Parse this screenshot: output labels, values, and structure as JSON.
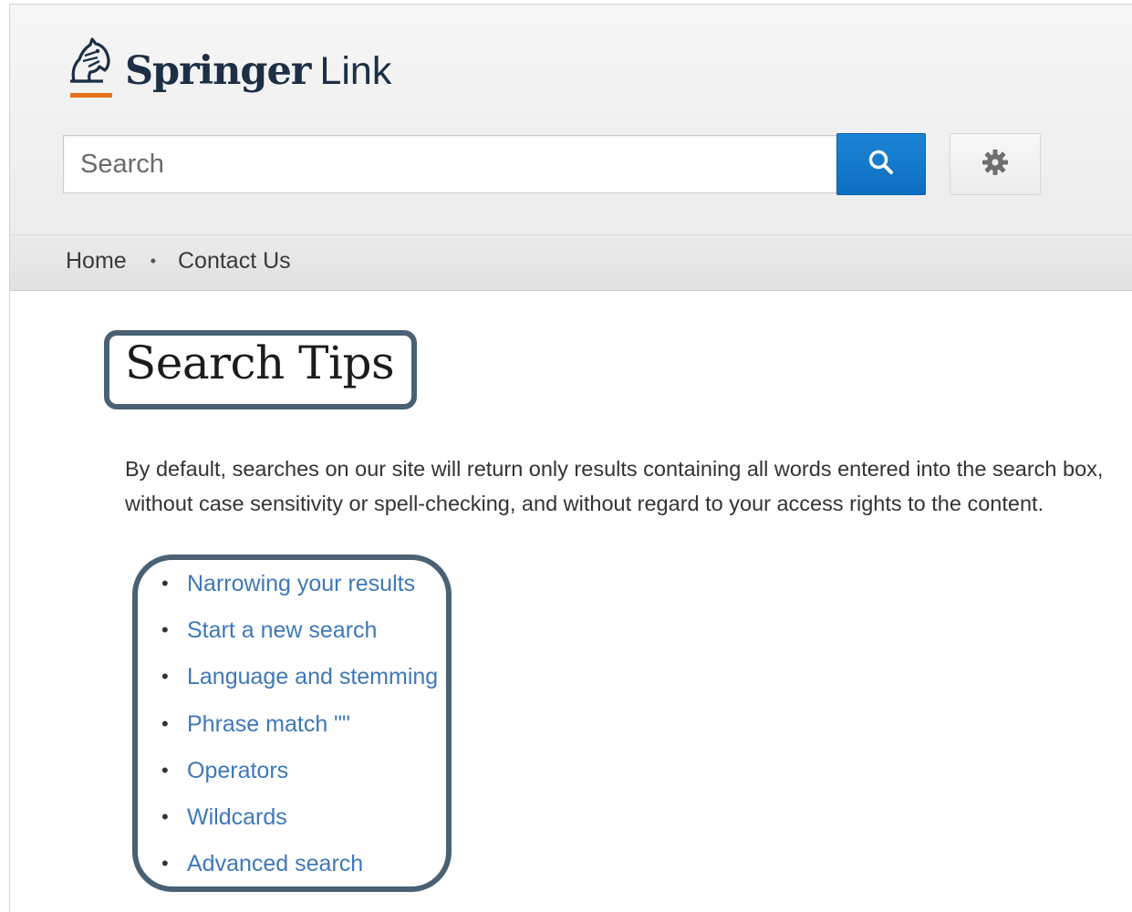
{
  "colors": {
    "brand_navy": "#1c2f45",
    "brand_orange": "#e5731d",
    "search_button_blue": "#1479cc",
    "link_blue": "#3e78b8",
    "annotation_border": "#4a6173"
  },
  "header": {
    "logo": {
      "icon": "springer-horse-icon",
      "brand_primary": "Springer",
      "brand_secondary": "Link"
    },
    "search": {
      "placeholder": "Search",
      "value": "",
      "submit_icon": "search-icon",
      "settings_icon": "gear-icon"
    }
  },
  "nav": {
    "items": [
      {
        "label": "Home"
      },
      {
        "label": "Contact Us"
      }
    ],
    "separator": "•"
  },
  "main": {
    "title": "Search Tips",
    "intro": "By default, searches on our site will return only results containing all words entered into the search box, without case sensitivity or spell-checking, and without regard to your access rights to the content.",
    "tips": [
      {
        "label": "Narrowing your results"
      },
      {
        "label": "Start a new search"
      },
      {
        "label": "Language and stemming"
      },
      {
        "label": "Phrase match \"\""
      },
      {
        "label": "Operators"
      },
      {
        "label": "Wildcards"
      },
      {
        "label": "Advanced search"
      }
    ]
  }
}
